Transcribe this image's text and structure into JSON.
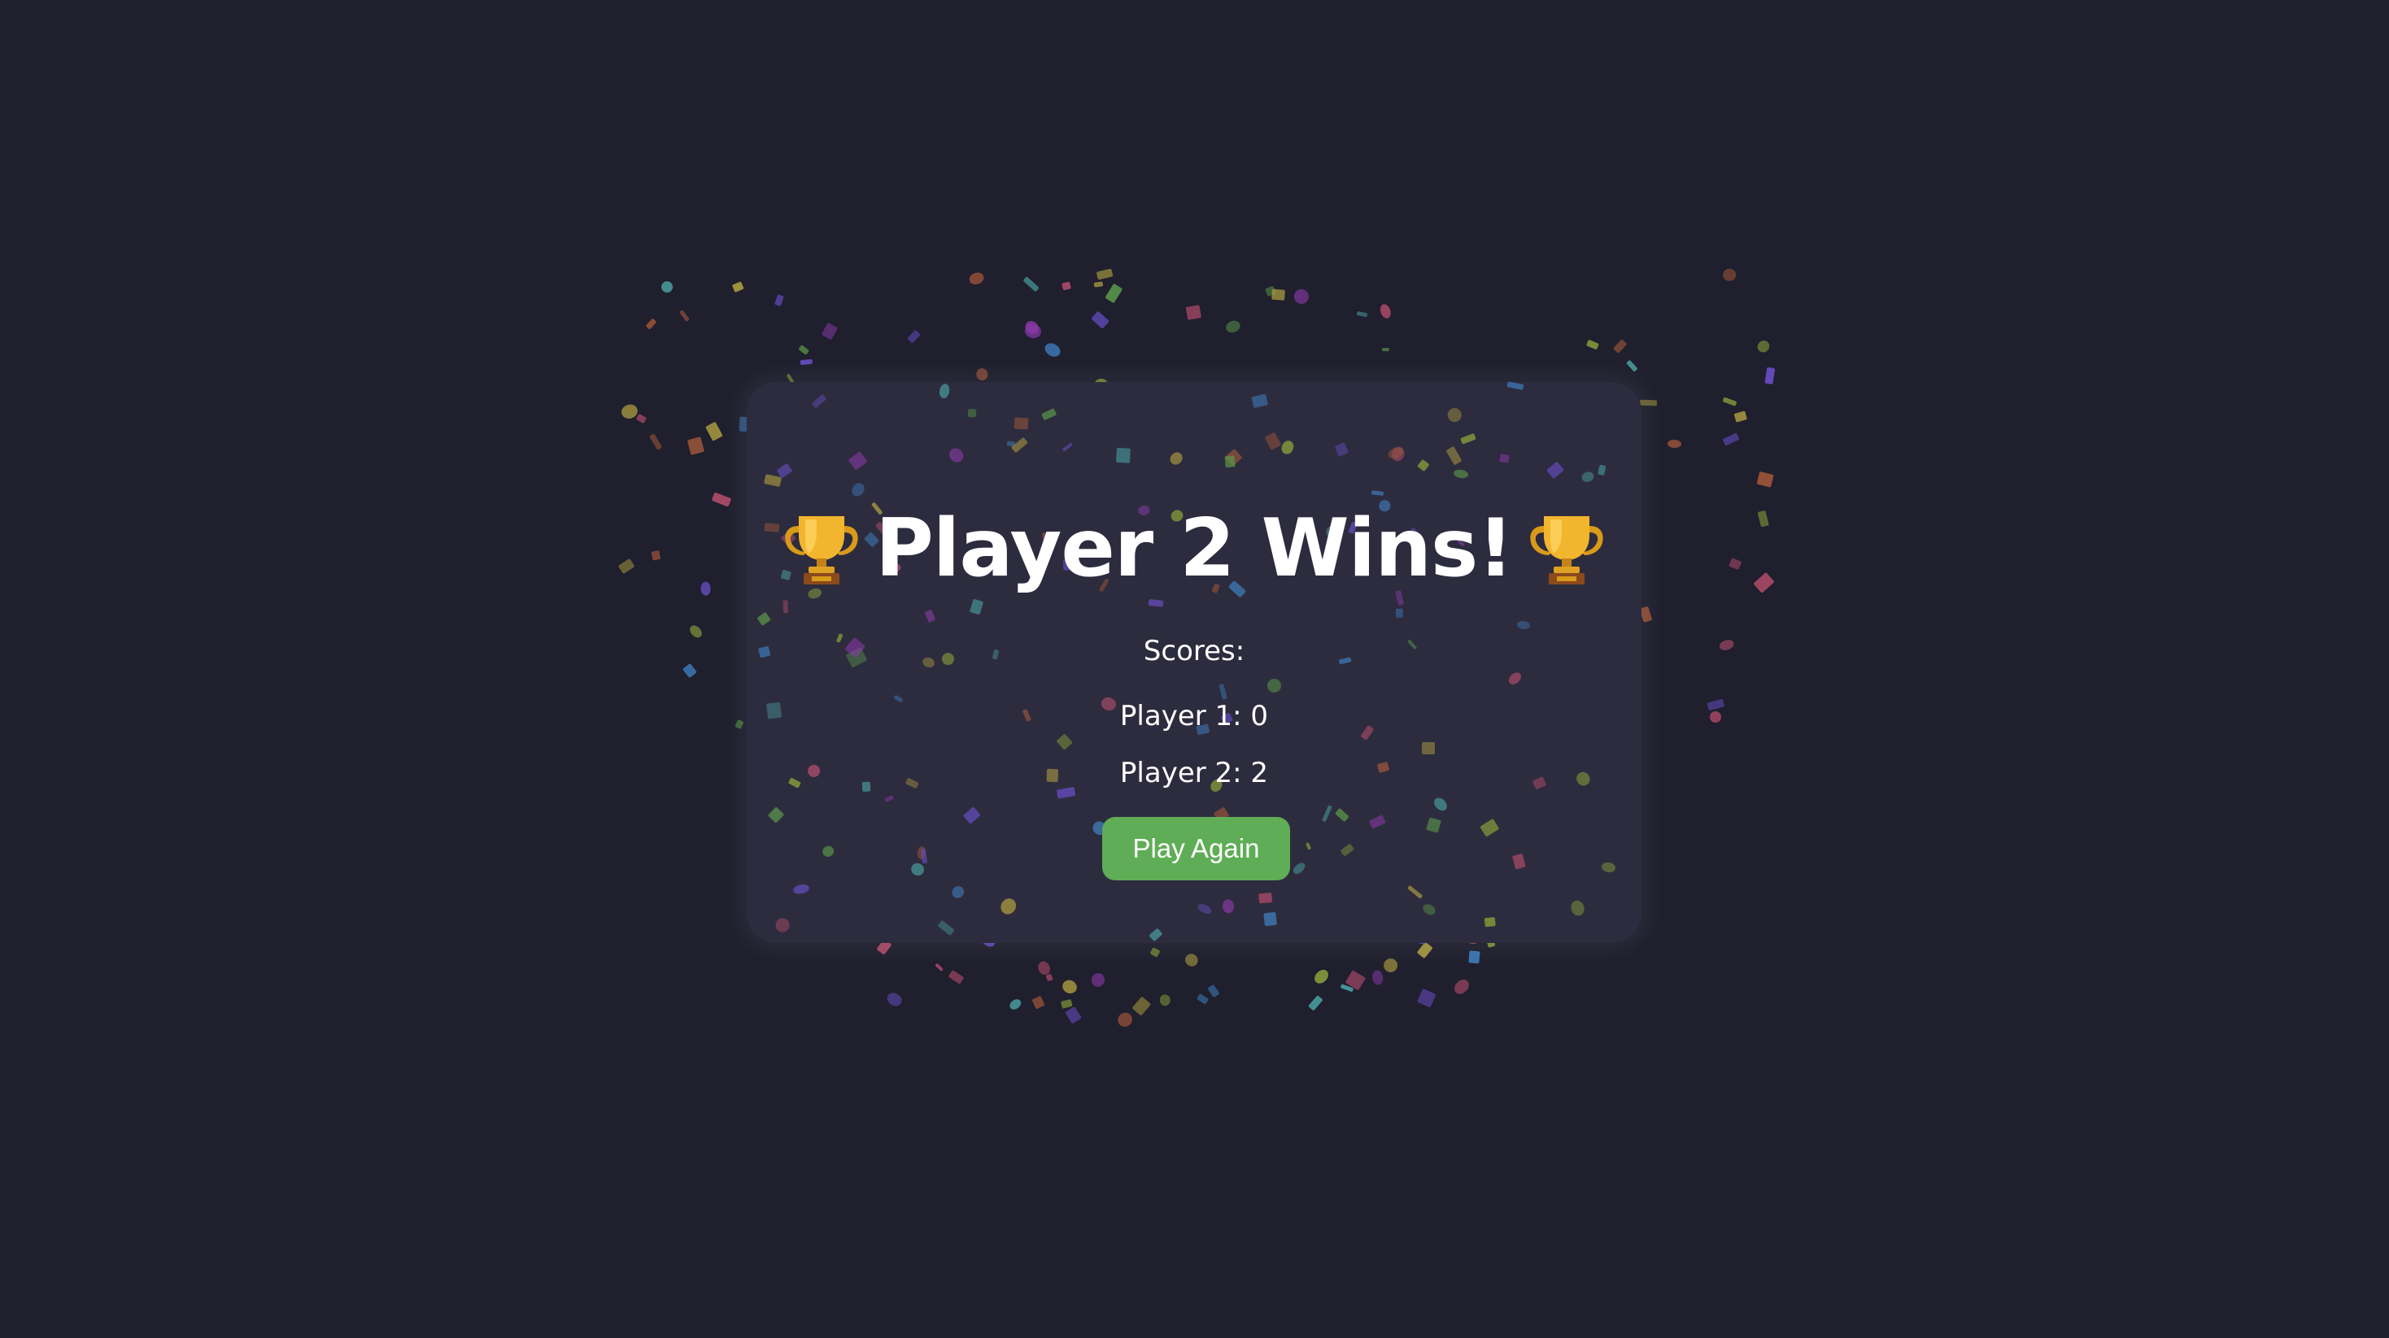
{
  "result": {
    "title": "Player 2 Wins!",
    "trophy_icon": "trophy-icon"
  },
  "scores": {
    "label": "Scores:",
    "players": [
      {
        "text": "Player 1: 0"
      },
      {
        "text": "Player 2: 2"
      }
    ]
  },
  "actions": {
    "play_again_label": "Play Again"
  },
  "colors": {
    "background": "#1f1f2e",
    "card": "#2d2c3e",
    "button": "#5fad56",
    "confetti": [
      "#6a4fc8",
      "#3f7fc0",
      "#8fa83a",
      "#a85a3a",
      "#5a9a4a",
      "#8a3aa8",
      "#b0a040",
      "#4aa0a0",
      "#c05070"
    ]
  }
}
